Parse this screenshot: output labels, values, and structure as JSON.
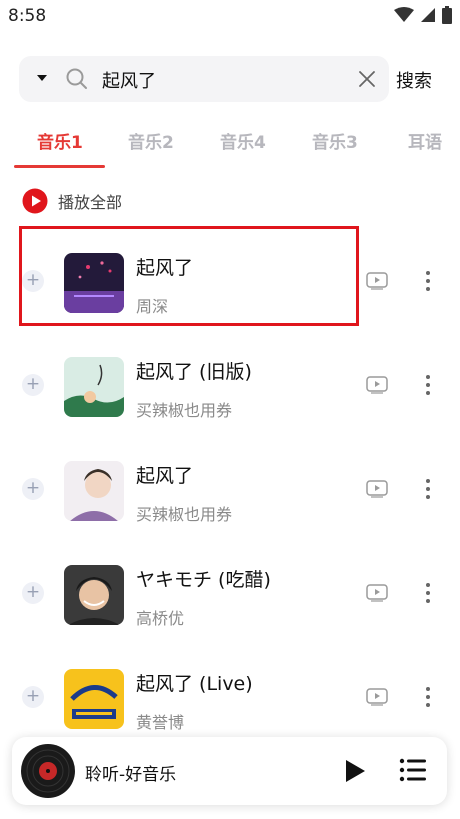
{
  "status_bar": {
    "time": "8:58",
    "icons": [
      "wifi-icon",
      "signal-icon",
      "battery-icon"
    ]
  },
  "search": {
    "query": "起风了",
    "button_label": "搜索",
    "icons": [
      "dropdown-arrow-icon",
      "search-icon",
      "clear-icon"
    ]
  },
  "tabs": [
    {
      "label": "音乐1",
      "active": true
    },
    {
      "label": "音乐2",
      "active": false
    },
    {
      "label": "音乐4",
      "active": false
    },
    {
      "label": "音乐3",
      "active": false
    },
    {
      "label": "耳语",
      "active": false
    }
  ],
  "play_all": {
    "label": "播放全部"
  },
  "songs": [
    {
      "title": "起风了",
      "artist": "周深",
      "highlighted": true
    },
    {
      "title": "起风了 (旧版)",
      "artist": "买辣椒也用券",
      "highlighted": false
    },
    {
      "title": "起风了",
      "artist": "买辣椒也用券",
      "highlighted": false
    },
    {
      "title": "ヤキモチ (吃醋)",
      "artist": "高桥优",
      "highlighted": false
    },
    {
      "title": "起风了 (Live)",
      "artist": "黄誉博",
      "highlighted": false
    }
  ],
  "player": {
    "title": "聆听-好音乐"
  },
  "colors": {
    "accent": "#e53935",
    "highlight_box": "#e0161c",
    "inactive_tab": "#b7b7bd"
  }
}
